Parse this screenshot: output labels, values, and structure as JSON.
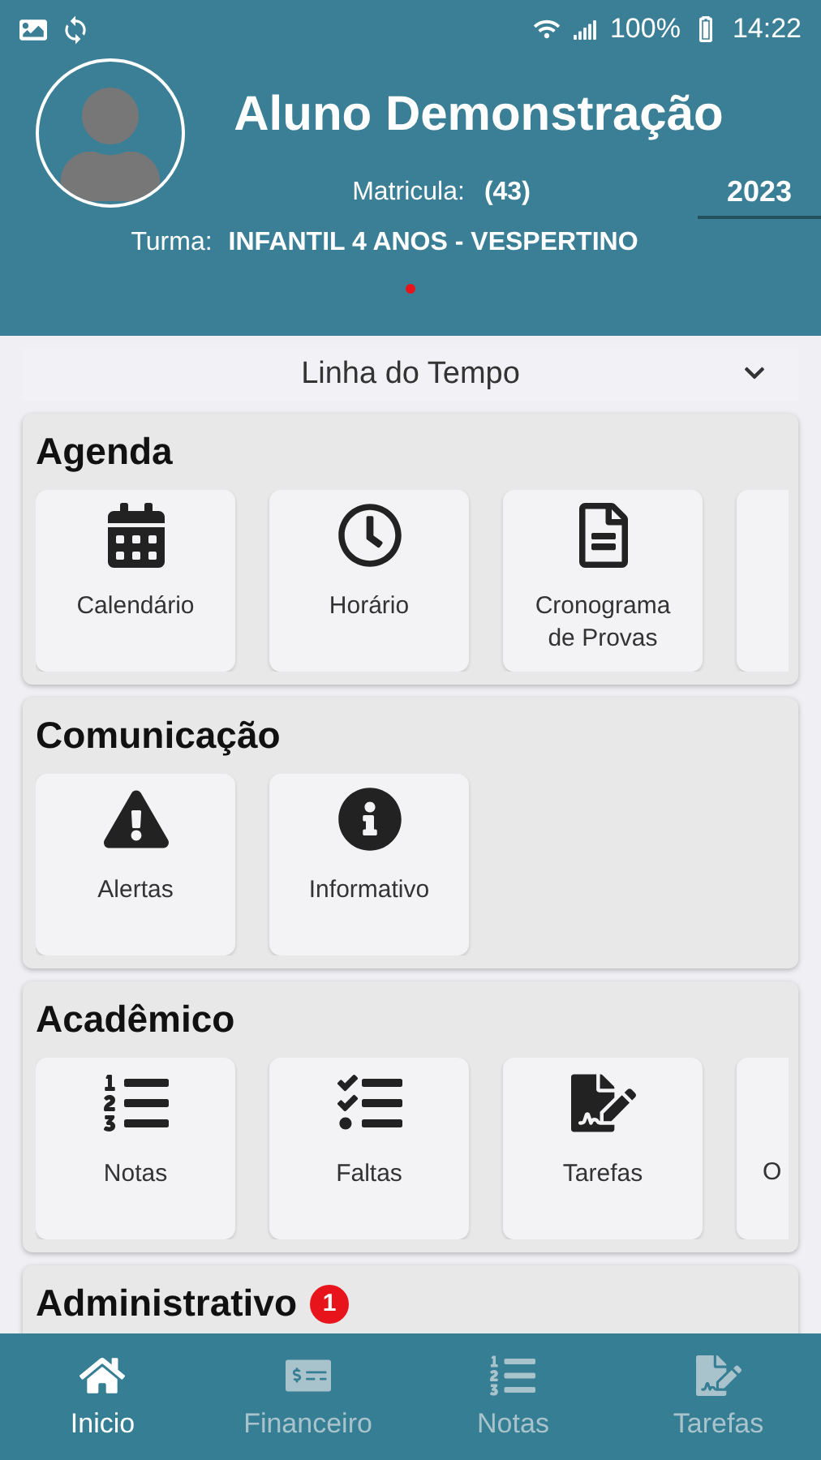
{
  "status_bar": {
    "battery": "100%",
    "time": "14:22"
  },
  "profile": {
    "name": "Aluno Demonstração",
    "enrollment_label": "Matricula:",
    "enrollment": "(43)",
    "year": "2023",
    "class_label": "Turma:",
    "class": "INFANTIL 4 ANOS - VESPERTINO"
  },
  "timeline": {
    "label": "Linha do Tempo",
    "expanded": false
  },
  "sections": [
    {
      "title": "Agenda",
      "items": [
        {
          "kind": "calendar",
          "label": "Calendário"
        },
        {
          "kind": "clock",
          "label": "Horário"
        },
        {
          "kind": "document",
          "label": "Cronograma de Provas"
        },
        {
          "kind": "clipped"
        }
      ]
    },
    {
      "title": "Comunicação",
      "items": [
        {
          "kind": "warning",
          "label": "Alertas"
        },
        {
          "kind": "info",
          "label": "Informativo"
        }
      ]
    },
    {
      "title": "Acadêmico",
      "items": [
        {
          "kind": "numbered",
          "label": "Notas"
        },
        {
          "kind": "checklist",
          "label": "Faltas"
        },
        {
          "kind": "edit",
          "label": "Tarefas"
        },
        {
          "kind": "clipped",
          "label": "O"
        }
      ]
    },
    {
      "title": "Administrativo",
      "badge": "1"
    }
  ],
  "bottom_nav": [
    {
      "kind": "home",
      "label": "Inicio",
      "selected": true
    },
    {
      "kind": "money",
      "label": "Financeiro",
      "selected": false
    },
    {
      "kind": "numbered",
      "label": "Notas",
      "selected": false
    },
    {
      "kind": "edit",
      "label": "Tarefas",
      "selected": false
    }
  ]
}
